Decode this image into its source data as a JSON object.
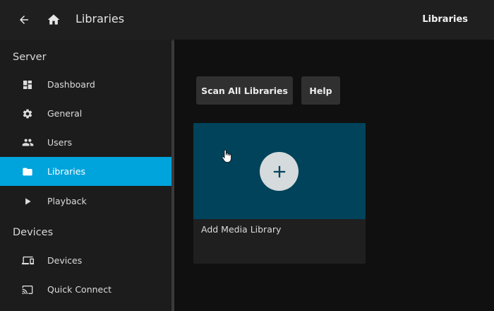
{
  "header": {
    "title": "Libraries",
    "right_title": "Libraries",
    "back_icon": "arrow-left-icon",
    "home_icon": "home-icon"
  },
  "sidebar": {
    "sections": [
      {
        "header": "Server",
        "items": [
          {
            "label": "Dashboard",
            "icon": "dashboard-icon"
          },
          {
            "label": "General",
            "icon": "gear-icon"
          },
          {
            "label": "Users",
            "icon": "people-icon"
          },
          {
            "label": "Libraries",
            "icon": "folder-icon",
            "active": true
          },
          {
            "label": "Playback",
            "icon": "play-icon"
          }
        ]
      },
      {
        "header": "Devices",
        "items": [
          {
            "label": "Devices",
            "icon": "devices-icon"
          },
          {
            "label": "Quick Connect",
            "icon": "cast-icon"
          }
        ]
      }
    ]
  },
  "main": {
    "scan_button": "Scan All Libraries",
    "help_button": "Help",
    "add_card": {
      "label": "Add Media Library",
      "icon": "plus-icon"
    }
  },
  "colors": {
    "accent": "#00a4dc",
    "card_image": "#00435a",
    "background": "#101010",
    "sidebar": "#1c1c1c",
    "topbar": "#1f1f1f"
  }
}
